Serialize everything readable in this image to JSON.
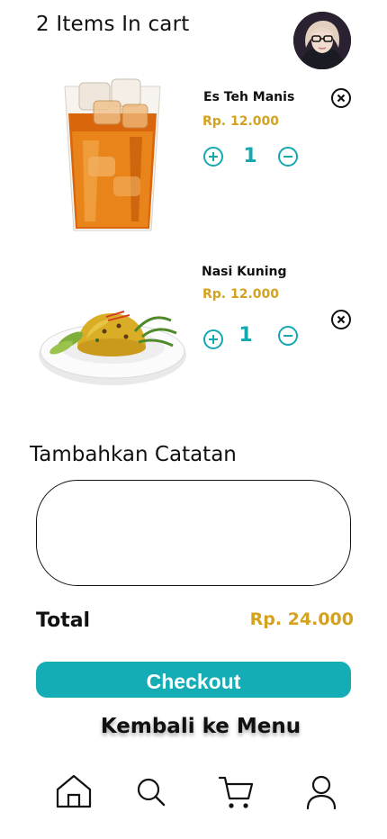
{
  "header": {
    "title": "2 Items In cart",
    "avatar_icon": "user-avatar-photo"
  },
  "cart": {
    "items": [
      {
        "name": "Es Teh Manis",
        "price": "Rp. 12.000",
        "quantity": "1",
        "image_icon": "iced-tea-glass"
      },
      {
        "name": "Nasi Kuning",
        "price": "Rp. 12.000",
        "quantity": "1",
        "image_icon": "yellow-rice-plate"
      }
    ],
    "icons": {
      "increase": "plus-circle-icon",
      "decrease": "minus-circle-icon",
      "remove": "close-circle-icon"
    }
  },
  "notes": {
    "label": "Tambahkan Catatan",
    "value": ""
  },
  "summary": {
    "total_label": "Total",
    "total_value": "Rp. 24.000"
  },
  "actions": {
    "checkout_label": "Checkout",
    "back_label": "Kembali ke Menu"
  },
  "bottom_nav": {
    "items": [
      "home-icon",
      "search-icon",
      "cart-icon",
      "user-icon"
    ]
  },
  "colors": {
    "accent": "#14adb5",
    "price": "#d4a21e",
    "text": "#111111"
  }
}
